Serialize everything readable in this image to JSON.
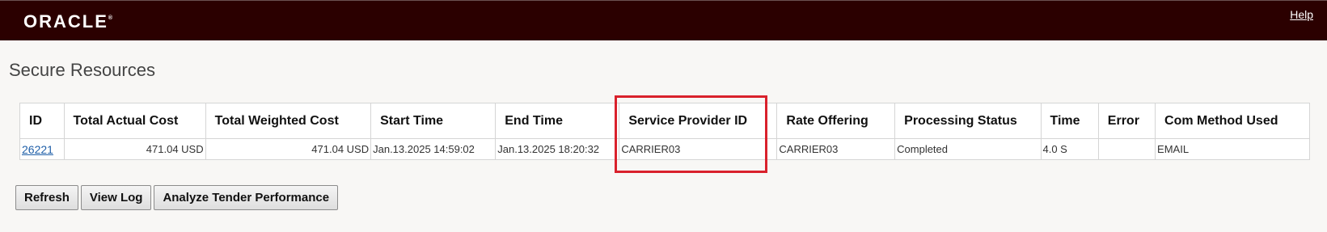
{
  "header": {
    "logo_text": "ORACLE",
    "logo_mark": "®",
    "help_label": "Help"
  },
  "page": {
    "title": "Secure Resources"
  },
  "table": {
    "columns": [
      "ID",
      "Total Actual Cost",
      "Total Weighted Cost",
      "Start Time",
      "End Time",
      "Service Provider ID",
      "Rate Offering",
      "Processing Status",
      "Time",
      "Error",
      "Com Method Used"
    ],
    "rows": [
      {
        "id": "26221",
        "total_actual_cost": "471.04 USD",
        "total_weighted_cost": "471.04 USD",
        "start_time": "Jan.13.2025 14:59:02",
        "end_time": "Jan.13.2025 18:20:32",
        "service_provider_id": "CARRIER03",
        "rate_offering": "CARRIER03",
        "processing_status": "Completed",
        "time": "4.0 S",
        "error": "",
        "com_method_used": "EMAIL"
      }
    ]
  },
  "buttons": {
    "refresh": "Refresh",
    "view_log": "View Log",
    "analyze": "Analyze Tender Performance"
  },
  "colors": {
    "header_bg": "#2b0000",
    "highlight_border": "#d9212c",
    "link": "#1f5fa8"
  }
}
